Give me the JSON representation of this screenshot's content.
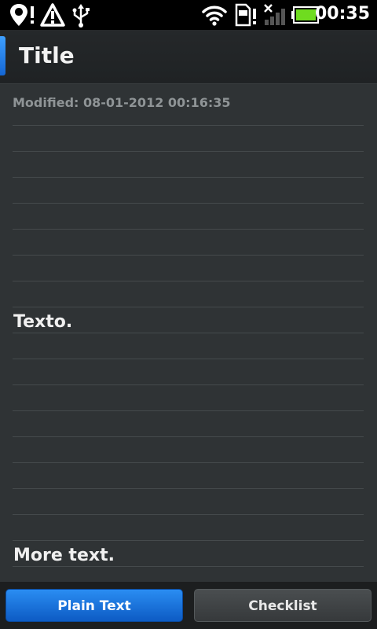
{
  "status_bar": {
    "time": "00:35",
    "icons": [
      "location-alert-icon",
      "warning-icon",
      "usb-icon",
      "wifi-icon",
      "sim-alert-icon",
      "signal-icon",
      "battery-icon"
    ]
  },
  "header": {
    "title": "Title"
  },
  "note": {
    "modified": "Modified: 08-01-2012 00:16:35",
    "lines": [
      "Texto.",
      "More text."
    ]
  },
  "footer": {
    "plain_text_label": "Plain Text",
    "checklist_label": "Checklist"
  },
  "colors": {
    "accent": "#1a75e0",
    "background": "#2f3335"
  }
}
